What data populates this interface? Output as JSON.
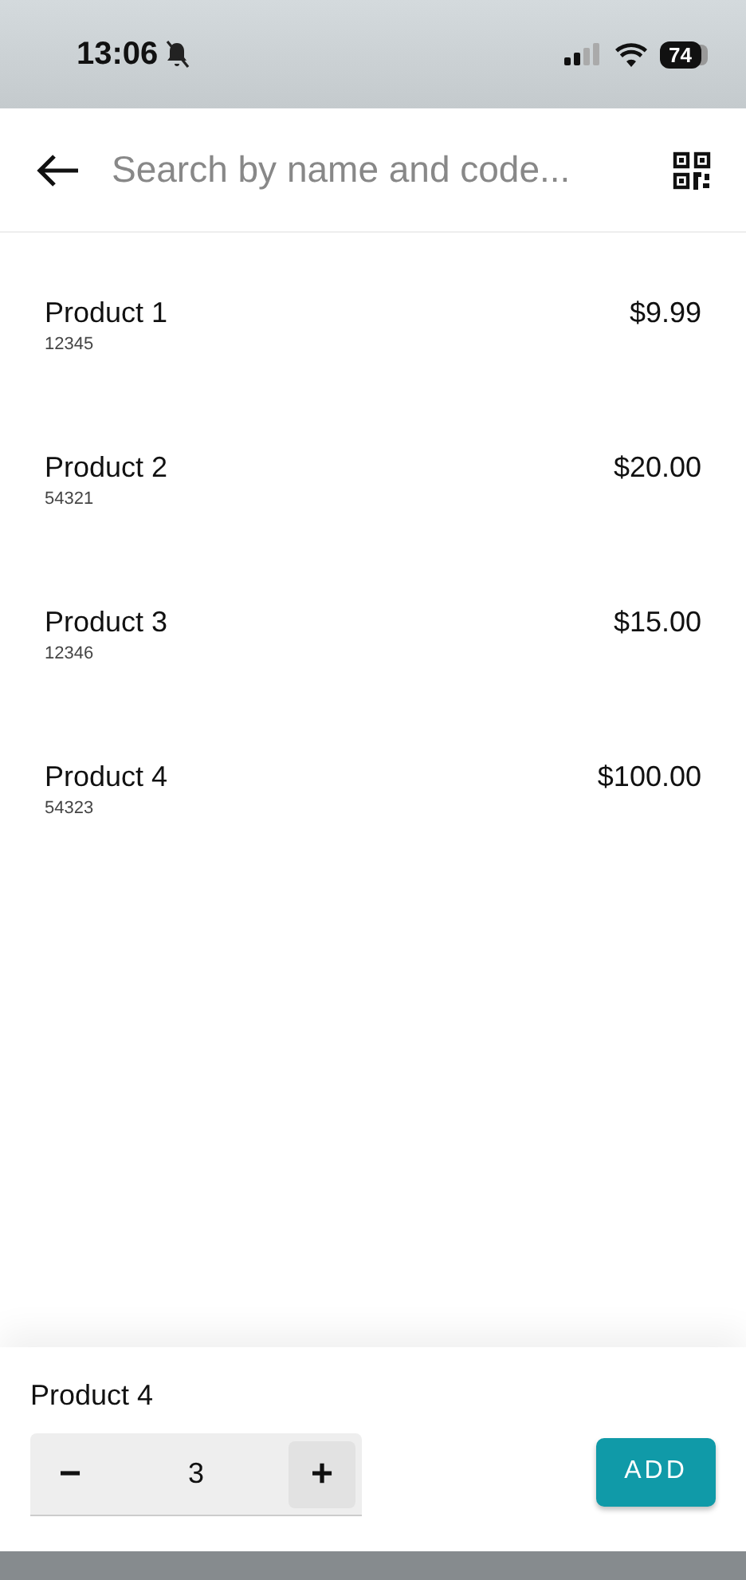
{
  "status_bar": {
    "time": "13:06",
    "battery": "74"
  },
  "search": {
    "placeholder": "Search by name and code..."
  },
  "products": [
    {
      "name": "Product 1",
      "code": "12345",
      "price": "$9.99"
    },
    {
      "name": "Product 2",
      "code": "54321",
      "price": "$20.00"
    },
    {
      "name": "Product 3",
      "code": "12346",
      "price": "$15.00"
    },
    {
      "name": "Product 4",
      "code": "54323",
      "price": "$100.00"
    }
  ],
  "selection": {
    "name": "Product 4",
    "decrement": "−",
    "quantity": "3",
    "increment": "+",
    "add": "ADD"
  }
}
